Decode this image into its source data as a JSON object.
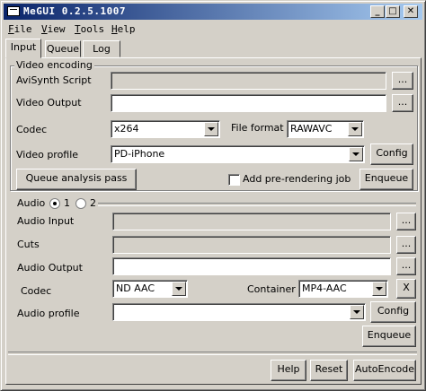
{
  "window": {
    "title": "MeGUI 0.2.5.1007",
    "minimize": "_",
    "maximize": "□",
    "close": "✕",
    "app_icon": "window-icon"
  },
  "menu": [
    {
      "accel": "F",
      "rest": "ile"
    },
    {
      "accel": "V",
      "rest": "iew"
    },
    {
      "accel": "T",
      "rest": "ools"
    },
    {
      "accel": "H",
      "rest": "elp"
    }
  ],
  "tabs": [
    "Input",
    "Queue",
    "Log"
  ],
  "video": {
    "legend": "Video encoding",
    "avisynth_label": "AviSynth Script",
    "avisynth_value": "",
    "output_label": "Video Output",
    "output_value": "",
    "browse": "...",
    "codec_label": "Codec",
    "codec_value": "x264",
    "file_format_label": "File format",
    "file_format_value": "RAWAVC",
    "profile_label": "Video profile",
    "profile_value": "PD-iPhone",
    "config": "Config",
    "queue_analysis": "Queue analysis pass",
    "add_prerender": "Add pre-rendering job",
    "enqueue": "Enqueue"
  },
  "audio": {
    "legend": "Audio",
    "radio1": "1",
    "radio2": "2",
    "input_label": "Audio Input",
    "cuts_label": "Cuts",
    "output_label": "Audio Output",
    "browse": "...",
    "codec_label": "Codec",
    "codec_value": "ND AAC",
    "container_label": "Container",
    "container_value": "MP4-AAC",
    "clear": "X",
    "profile_label": "Audio profile",
    "profile_value": "",
    "config": "Config",
    "enqueue": "Enqueue"
  },
  "footer": {
    "help": "Help",
    "reset": "Reset",
    "autoencode": "AutoEncode"
  }
}
